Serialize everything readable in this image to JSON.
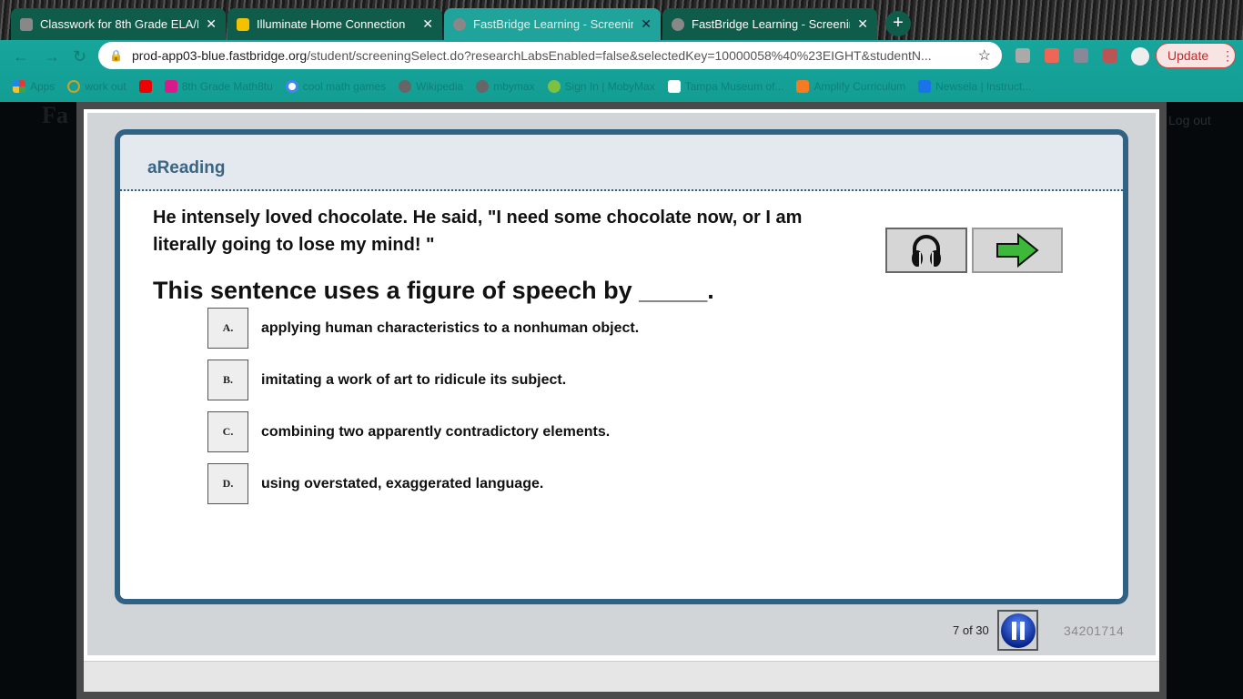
{
  "browser": {
    "tabs": [
      {
        "title": "Classwork for 8th Grade ELA/H",
        "active": false
      },
      {
        "title": "Illuminate Home Connection",
        "active": false
      },
      {
        "title": "FastBridge Learning - Screenin",
        "active": true
      },
      {
        "title": "FastBridge Learning - Screenin",
        "active": false
      }
    ],
    "new_tab": "+",
    "close": "✕",
    "url_host": "prod-app03-blue.fastbridge.org",
    "url_path": "/student/screeningSelect.do?researchLabsEnabled=false&selectedKey=10000058%40%23EIGHT&studentN...",
    "update_label": "Update",
    "bookmarks": [
      {
        "label": "Apps",
        "color": "#e53935"
      },
      {
        "label": "work out",
        "color": "#c9a227"
      },
      {
        "label": "",
        "color": "#e00"
      },
      {
        "label": "8th Grade Math8tu",
        "color": "#d81b8a"
      },
      {
        "label": "cool math games",
        "color": "#4285f4"
      },
      {
        "label": "Wikipedia",
        "color": "#666"
      },
      {
        "label": "mbymax",
        "color": "#666"
      },
      {
        "label": "Sign In | MobyMax",
        "color": "#7cc142"
      },
      {
        "label": "Tampa Museum of...",
        "color": "#fff"
      },
      {
        "label": "Amplify Curriculum",
        "color": "#f47b20"
      },
      {
        "label": "Newsela | Instruct...",
        "color": "#1a73e8"
      }
    ]
  },
  "background": {
    "logo": "Fa",
    "logout": "Log out"
  },
  "assessment": {
    "title": "aReading",
    "passage": "He intensely loved chocolate. He said, \"I need some chocolate now, or I am literally going to lose my mind! \"",
    "question": "This sentence uses a figure of speech by _____.",
    "choices": [
      {
        "key": "A.",
        "text": "applying human characteristics to a nonhuman object."
      },
      {
        "key": "B.",
        "text": "imitating a work of art to ridicule its subject."
      },
      {
        "key": "C.",
        "text": "combining two apparently contradictory elements."
      },
      {
        "key": "D.",
        "text": "using overstated, exaggerated language."
      }
    ],
    "progress": "7 of 30",
    "student_id": "34201714",
    "colors": {
      "border": "#326283",
      "next_arrow": "#3db83a",
      "pause": "#0a2aa0"
    }
  }
}
